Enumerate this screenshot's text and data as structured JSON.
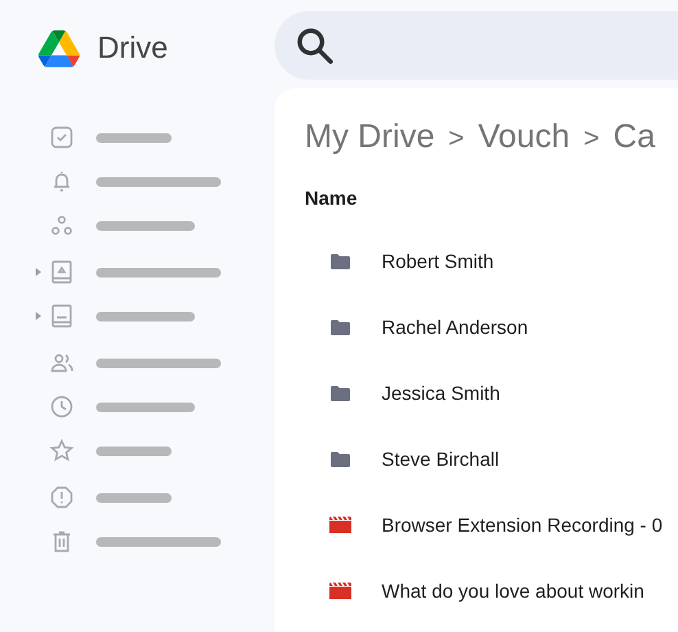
{
  "app": {
    "name": "Drive"
  },
  "sidebar": {
    "groups": [
      {
        "items": [
          {
            "expandable": false
          },
          {
            "expandable": false
          },
          {
            "expandable": false
          }
        ]
      },
      {
        "items": [
          {
            "expandable": true
          },
          {
            "expandable": true
          }
        ]
      },
      {
        "items": [
          {
            "expandable": false
          },
          {
            "expandable": false
          },
          {
            "expandable": false
          }
        ]
      },
      {
        "items": [
          {
            "expandable": false
          },
          {
            "expandable": false
          }
        ]
      }
    ]
  },
  "breadcrumb": [
    "My Drive",
    "Vouch",
    "Ca"
  ],
  "breadcrumb_separator": ">",
  "table": {
    "columns": [
      "Name"
    ],
    "rows": [
      {
        "kind": "folder",
        "name": "Robert Smith"
      },
      {
        "kind": "folder",
        "name": "Rachel Anderson"
      },
      {
        "kind": "folder",
        "name": "Jessica Smith"
      },
      {
        "kind": "folder",
        "name": "Steve Birchall"
      },
      {
        "kind": "video",
        "name": "Browser Extension Recording - 0"
      },
      {
        "kind": "video",
        "name": "What do you love about workin"
      }
    ]
  }
}
